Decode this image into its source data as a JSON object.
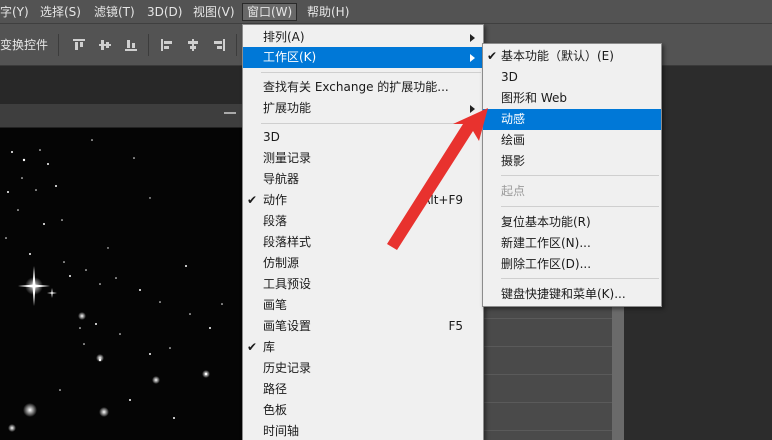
{
  "menubar": {
    "items": [
      "字(Y)",
      "选择(S)",
      "滤镜(T)",
      "3D(D)",
      "视图(V)",
      "窗口(W)",
      "帮助(H)"
    ],
    "active_index": 5
  },
  "options_bar": {
    "label": "变换控件"
  },
  "window_menu": {
    "items": [
      {
        "label": "排列(A)",
        "submenu": true
      },
      {
        "label": "工作区(K)",
        "submenu": true,
        "highlighted": true
      },
      {
        "label": "查找有关 Exchange 的扩展功能..."
      },
      {
        "label": "扩展功能",
        "submenu": true
      },
      {
        "label": "3D"
      },
      {
        "label": "测量记录"
      },
      {
        "label": "导航器"
      },
      {
        "label": "动作",
        "checked": true,
        "shortcut": "Alt+F9"
      },
      {
        "label": "段落"
      },
      {
        "label": "段落样式"
      },
      {
        "label": "仿制源"
      },
      {
        "label": "工具预设"
      },
      {
        "label": "画笔"
      },
      {
        "label": "画笔设置",
        "shortcut": "F5"
      },
      {
        "label": "库",
        "checked": true
      },
      {
        "label": "历史记录"
      },
      {
        "label": "路径"
      },
      {
        "label": "色板"
      },
      {
        "label": "时间轴"
      }
    ]
  },
  "workspace_menu": {
    "items": [
      {
        "label": "基本功能（默认）(E)",
        "checked": true
      },
      {
        "label": "3D"
      },
      {
        "label": "图形和 Web"
      },
      {
        "label": "动感",
        "highlighted": true
      },
      {
        "label": "绘画"
      },
      {
        "label": "摄影"
      },
      {
        "label": "起点",
        "disabled": true
      },
      {
        "label": "复位基本功能(R)"
      },
      {
        "label": "新建工作区(N)..."
      },
      {
        "label": "删除工作区(D)..."
      },
      {
        "label": "键盘快捷键和菜单(K)..."
      }
    ]
  },
  "colors": {
    "highlight": "#0078d7",
    "annotation_arrow": "#e8322e",
    "menu_bg": "#f0f0f0",
    "app_bg": "#535353"
  },
  "icons": {
    "check": "✔"
  }
}
